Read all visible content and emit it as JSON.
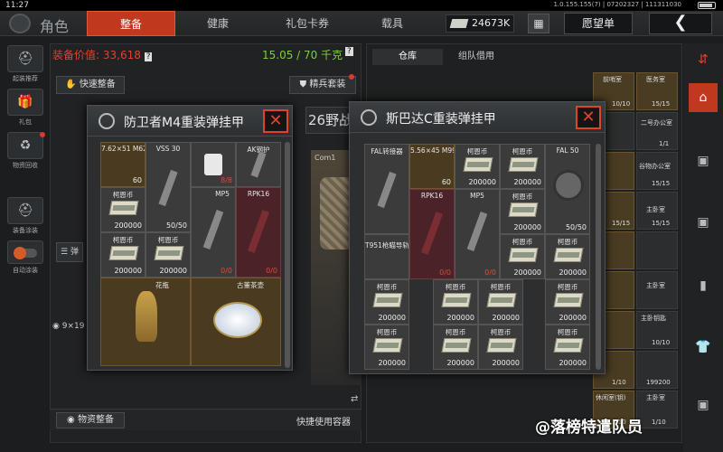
{
  "status": {
    "time": "11:27",
    "version": "1.0.155.155(7) | 07202327 | 111311030"
  },
  "header": {
    "title": "角色",
    "tabs": [
      "整备",
      "健康",
      "礼包卡券",
      "载具"
    ],
    "active_tab": "整备",
    "currency": "24673K",
    "wishlist": "愿望单",
    "back": "❮"
  },
  "sidebar": {
    "items": [
      {
        "label": "起装推荐"
      },
      {
        "label": "礼包"
      },
      {
        "label": "物资回收"
      },
      {
        "label": "装备涂装"
      },
      {
        "label": "自动涂装"
      }
    ]
  },
  "loadout": {
    "value_label": "装备价值:",
    "value": "33,618",
    "weight": "15.05 / 70 千克",
    "quick_equip": "快速整备",
    "elite_suit": "精兵套装",
    "partial_title": "26野战",
    "partial_com": "Com1",
    "bottom_left": "物资整备",
    "bottom_right": "快捷使用容器",
    "grid_size": "9×19"
  },
  "warehouse": {
    "tabs": [
      "仓库",
      "组队借用"
    ],
    "column_items": [
      {
        "name": "前哨室",
        "qty": "10/10"
      },
      {
        "name": "医务室",
        "qty": "15/15"
      },
      {
        "name": "",
        "qty": ""
      },
      {
        "name": "二号办公室",
        "qty": "1/1"
      },
      {
        "name": "",
        "qty": ""
      },
      {
        "name": "谷物办公室",
        "qty": "15/15"
      },
      {
        "name": "",
        "qty": "15/15"
      },
      {
        "name": "主卧室",
        "qty": "15/15"
      },
      {
        "name": "",
        "qty": ""
      },
      {
        "name": "",
        "qty": ""
      },
      {
        "name": "",
        "qty": ""
      },
      {
        "name": "主卧室",
        "qty": ""
      },
      {
        "name": "主卧钥匙",
        "qty": "10/10"
      },
      {
        "name": "",
        "qty": "199200"
      },
      {
        "name": "",
        "qty": "1/10"
      },
      {
        "name": "休闲室(钥)",
        "qty": "1/10"
      },
      {
        "name": "主卧室",
        "qty": "1/10"
      }
    ]
  },
  "popup_left": {
    "title": "防卫者M4重装弹挂甲",
    "close": "✕",
    "cells": [
      {
        "name": "7.62×51 M62",
        "qty": "60",
        "gold": true
      },
      {
        "name": "VSS 30",
        "qty": "50/50"
      },
      {
        "name": "",
        "qty": "8/8",
        "red_qty": true
      },
      {
        "name": "AK钢护",
        "qty": ""
      },
      {
        "name": "柯恩币",
        "qty": "200000"
      },
      {
        "name": "MP5",
        "qty": "0/0",
        "red_qty": true
      },
      {
        "name": "RPK16",
        "qty": "0/0",
        "red": true,
        "red_qty": true
      },
      {
        "name": "柯恩币",
        "qty": "200000"
      },
      {
        "name": "柯恩币",
        "qty": "200000"
      },
      {
        "name": "花瓶",
        "qty": ""
      },
      {
        "name": "古董茶壶",
        "qty": ""
      }
    ]
  },
  "popup_right": {
    "title": "斯巴达C重装弹挂甲",
    "close": "✕",
    "cells": [
      {
        "name": "FAL转接器",
        "qty": ""
      },
      {
        "name": "5.56×45 M995",
        "qty": "60",
        "gold": true
      },
      {
        "name": "柯恩币",
        "qty": "200000"
      },
      {
        "name": "柯恩币",
        "qty": "200000"
      },
      {
        "name": "FAL 50",
        "qty": "50/50"
      },
      {
        "name": "RPK16",
        "qty": "0/0",
        "red": true,
        "red_qty": true
      },
      {
        "name": "MP5",
        "qty": "0/0",
        "red_qty": true
      },
      {
        "name": "柯恩币",
        "qty": "200000"
      },
      {
        "name": "T951枪瞄导轨",
        "qty": ""
      },
      {
        "name": "柯恩币",
        "qty": "200000"
      },
      {
        "name": "柯恩币",
        "qty": "200000"
      },
      {
        "name": "柯恩币",
        "qty": "200000"
      },
      {
        "name": "柯恩币",
        "qty": "200000"
      },
      {
        "name": "柯恩币",
        "qty": "200000"
      },
      {
        "name": "柯恩币",
        "qty": "200000"
      },
      {
        "name": "柯恩币",
        "qty": "200000"
      },
      {
        "name": "柯恩币",
        "qty": "200000"
      },
      {
        "name": "柯恩币",
        "qty": "200000"
      },
      {
        "name": "柯恩币",
        "qty": "200000"
      },
      {
        "name": "柯恩币",
        "qty": "200000"
      }
    ]
  },
  "watermark": "@落榜特遣队员",
  "colors": {
    "accent": "#c0391e",
    "value_red": "#e0432c",
    "weight_green": "#7ccf3c"
  }
}
